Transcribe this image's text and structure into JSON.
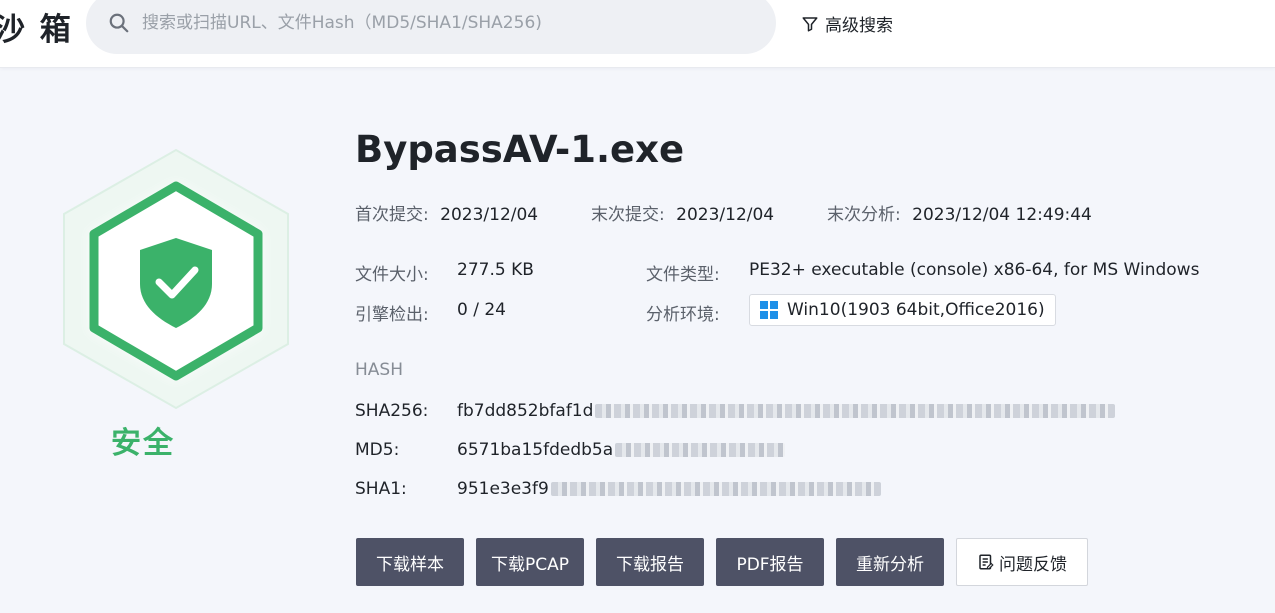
{
  "header": {
    "brand": "沙 箱",
    "search_placeholder": "搜索或扫描URL、文件Hash（MD5/SHA1/SHA256)",
    "advanced_search": "高级搜索"
  },
  "verdict": {
    "label": "安全",
    "color": "#3bb26a",
    "icon": "shield-check-icon"
  },
  "file": {
    "name": "BypassAV-1.exe",
    "first_submit_label": "首次提交:",
    "first_submit": "2023/12/04",
    "last_submit_label": "末次提交:",
    "last_submit": "2023/12/04",
    "last_analysis_label": "末次分析:",
    "last_analysis": "2023/12/04 12:49:44",
    "size_label": "文件大小:",
    "size": "277.5 KB",
    "type_label": "文件类型:",
    "type": "PE32+ executable (console) x86-64, for MS Windows",
    "engines_label": "引擎检出:",
    "engines": "0 / 24",
    "env_label": "分析环境:",
    "env": "Win10(1903 64bit,Office2016)",
    "env_icon": "windows-icon"
  },
  "hash": {
    "heading": "HASH",
    "sha256_label": "SHA256:",
    "sha256_visible": "fb7dd852bfaf1d",
    "md5_label": "MD5:",
    "md5_visible": "6571ba15fdedb5a",
    "sha1_label": "SHA1:",
    "sha1_visible": "951e3e3f9"
  },
  "actions": {
    "download_sample": "下载样本",
    "download_pcap": "下载PCAP",
    "download_report": "下载报告",
    "pdf_report": "PDF报告",
    "reanalyze": "重新分析",
    "feedback": "问题反馈"
  },
  "colors": {
    "button_dark": "#4e5266",
    "safe_green": "#3bb26a"
  }
}
